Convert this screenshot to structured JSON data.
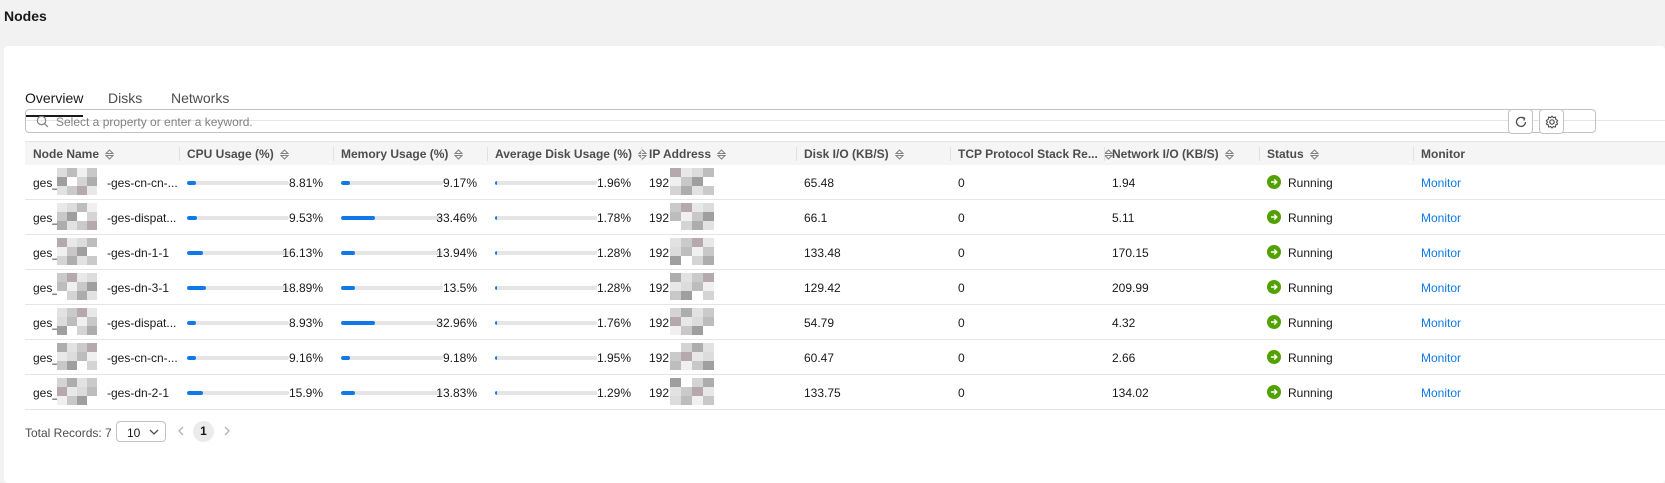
{
  "page": {
    "title": "Nodes"
  },
  "tabs": [
    {
      "label": "Overview",
      "active": true
    },
    {
      "label": "Disks",
      "active": false
    },
    {
      "label": "Networks",
      "active": false
    }
  ],
  "search": {
    "placeholder": "Select a property or enter a keyword."
  },
  "toolbar": {
    "refresh_icon": "refresh-icon",
    "settings_icon": "settings-icon"
  },
  "table": {
    "columns": [
      "Node Name",
      "CPU Usage (%)",
      "Memory Usage (%)",
      "Average Disk Usage (%)",
      "IP Address",
      "Disk I/O (KB/S)",
      "TCP Protocol Stack Re...",
      "Network I/O (KB/S)",
      "Status",
      "Monitor"
    ],
    "rows": [
      {
        "name_prefix": "ges_",
        "name_suffix": "-ges-cn-cn-...",
        "cpu": "8.81%",
        "cpu_val": 8.81,
        "mem": "9.17%",
        "mem_val": 9.17,
        "disk": "1.96%",
        "disk_val": 1.96,
        "ip_prefix": "192",
        "disk_io": "65.48",
        "tcp": "0",
        "net_io": "1.94",
        "status": "Running",
        "monitor": "Monitor"
      },
      {
        "name_prefix": "ges_",
        "name_suffix": "-ges-dispat...",
        "cpu": "9.53%",
        "cpu_val": 9.53,
        "mem": "33.46%",
        "mem_val": 33.46,
        "disk": "1.78%",
        "disk_val": 1.78,
        "ip_prefix": "192",
        "disk_io": "66.1",
        "tcp": "0",
        "net_io": "5.11",
        "status": "Running",
        "monitor": "Monitor"
      },
      {
        "name_prefix": "ges_",
        "name_suffix": "-ges-dn-1-1",
        "cpu": "16.13%",
        "cpu_val": 16.13,
        "mem": "13.94%",
        "mem_val": 13.94,
        "disk": "1.28%",
        "disk_val": 1.28,
        "ip_prefix": "192",
        "disk_io": "133.48",
        "tcp": "0",
        "net_io": "170.15",
        "status": "Running",
        "monitor": "Monitor"
      },
      {
        "name_prefix": "ges_",
        "name_suffix": "-ges-dn-3-1",
        "cpu": "18.89%",
        "cpu_val": 18.89,
        "mem": "13.5%",
        "mem_val": 13.5,
        "disk": "1.28%",
        "disk_val": 1.28,
        "ip_prefix": "192",
        "disk_io": "129.42",
        "tcp": "0",
        "net_io": "209.99",
        "status": "Running",
        "monitor": "Monitor"
      },
      {
        "name_prefix": "ges_",
        "name_suffix": "-ges-dispat...",
        "cpu": "8.93%",
        "cpu_val": 8.93,
        "mem": "32.96%",
        "mem_val": 32.96,
        "disk": "1.76%",
        "disk_val": 1.76,
        "ip_prefix": "192",
        "disk_io": "54.79",
        "tcp": "0",
        "net_io": "4.32",
        "status": "Running",
        "monitor": "Monitor"
      },
      {
        "name_prefix": "ges_",
        "name_suffix": "-ges-cn-cn-...",
        "cpu": "9.16%",
        "cpu_val": 9.16,
        "mem": "9.18%",
        "mem_val": 9.18,
        "disk": "1.95%",
        "disk_val": 1.95,
        "ip_prefix": "192",
        "disk_io": "60.47",
        "tcp": "0",
        "net_io": "2.66",
        "status": "Running",
        "monitor": "Monitor"
      },
      {
        "name_prefix": "ges_",
        "name_suffix": "-ges-dn-2-1",
        "cpu": "15.9%",
        "cpu_val": 15.9,
        "mem": "13.83%",
        "mem_val": 13.83,
        "disk": "1.29%",
        "disk_val": 1.29,
        "ip_prefix": "192",
        "disk_io": "133.75",
        "tcp": "0",
        "net_io": "134.02",
        "status": "Running",
        "monitor": "Monitor"
      }
    ]
  },
  "pagination": {
    "total_label": "Total Records: 7",
    "page_size": "10",
    "current_page": "1"
  },
  "colors": {
    "accent": "#0f79e8",
    "status_running": "#52a100",
    "bar_track": "#e5e5e5"
  }
}
